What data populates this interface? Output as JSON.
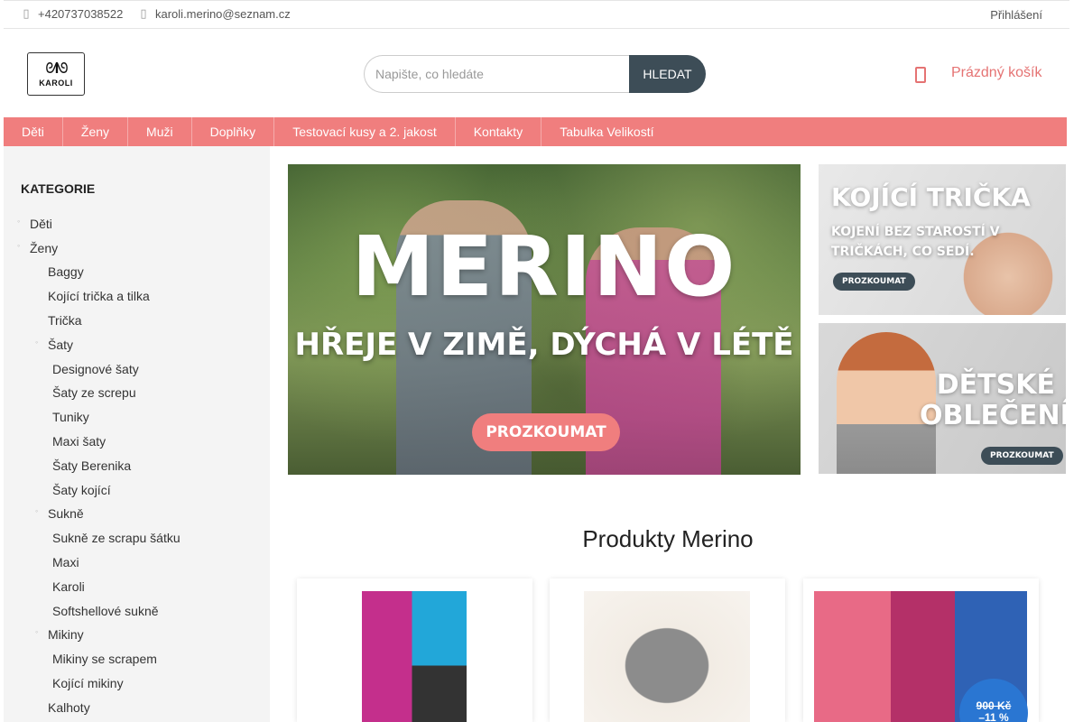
{
  "topbar": {
    "phone": "+420737038522",
    "email": "karoli.merino@seznam.cz",
    "login": "Přihlášení"
  },
  "header": {
    "logo_text": "KAROLI",
    "search_placeholder": "Napište, co hledáte",
    "search_button": "Hledat",
    "cart_label": "Prázdný košík"
  },
  "nav": {
    "items": [
      "Děti",
      "Ženy",
      "Muži",
      "Doplňky",
      "Testovací kusy a 2. jakost",
      "Kontakty",
      "Tabulka Velikostí"
    ]
  },
  "sidebar": {
    "heading": "KATEGORIE",
    "categories": [
      "Děti",
      "Ženy",
      "Baggy",
      "Kojící trička a tilka",
      "Trička",
      "Šaty",
      "Designové šaty",
      "Šaty ze screpu",
      "Tuniky",
      "Maxi šaty",
      "Šaty Berenika",
      "Šaty kojící",
      "Sukně",
      "Sukně ze scrapu šátku",
      "Maxi",
      "Karoli",
      "Softshellové sukně",
      "Mikiny",
      "Mikiny se scrapem",
      "Kojící mikiny",
      "Kalhoty"
    ]
  },
  "banners": {
    "main_title": "MERINO",
    "main_subtitle": "HŘEJE V ZIMĚ, DÝCHÁ V LÉTĚ",
    "main_cta": "PROZKOUMAT",
    "side1_title": "KOJÍCÍ TRIČKA",
    "side1_text": "KOJENÍ BEZ STAROSTÍ V TRIČKÁCH, CO SEDÍ.",
    "side1_cta": "PROZKOUMAT",
    "side2_title": "DĚTSKÉ OBLEČENÍ",
    "side2_cta": "PROZKOUMAT"
  },
  "products": {
    "title": "Produkty Merino",
    "discount_old_price": "900 Kč",
    "discount_percent": "–11 %"
  },
  "colors": {
    "accent": "#f07e7e",
    "dark": "#3d4d57",
    "sale_badge": "#2a76d2"
  }
}
